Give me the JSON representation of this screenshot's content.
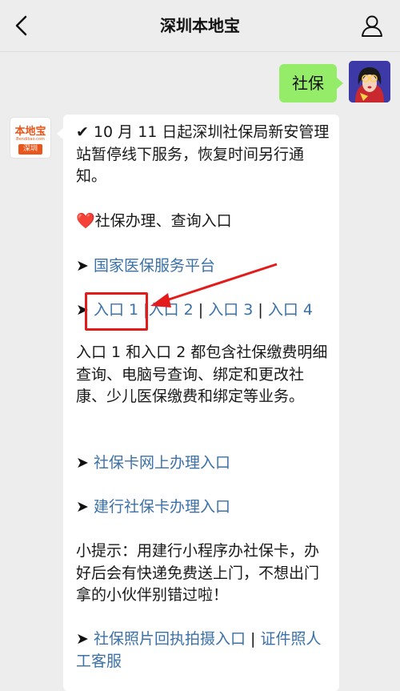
{
  "navbar": {
    "title": "深圳本地宝",
    "back_icon": "chevron-left-icon",
    "profile_icon": "person-icon"
  },
  "user_message": {
    "text": "社保"
  },
  "bot_avatar": {
    "logo_text": "本地宝",
    "logo_url": "Bendibao.com",
    "logo_city": "深圳",
    "brand_color": "#e8561b"
  },
  "bot_message": {
    "notice": "✔ 10 月 11 日起深圳社保局新安管理站暂停线下服务，恢复时间另行通知。",
    "heart": "❤️",
    "section_title": "社保办理、查询入口",
    "arrow": "➤",
    "link_national": "国家医保服务平台",
    "entries": [
      "入口 1",
      "入口 2",
      "入口 3",
      "入口 4"
    ],
    "separator": "|",
    "entries_desc": "入口 1 和入口 2 都包含社保缴费明细查询、电脑号查询、绑定和更改社康、少儿医保缴费和绑定等业务。",
    "link_card_online": "社保卡网上办理入口",
    "link_ccb_card": "建行社保卡办理入口",
    "tip": "小提示：用建行小程序办社保卡，办好后会有快递免费送上门，不想出门拿的小伙伴别错过啦！",
    "link_photo_receipt": "社保照片回执拍摄入口",
    "link_photo_service": "证件照人工客服"
  },
  "colors": {
    "link": "#3a71a8",
    "user_bubble": "#95ec69",
    "annotation": "#e31b1b"
  }
}
